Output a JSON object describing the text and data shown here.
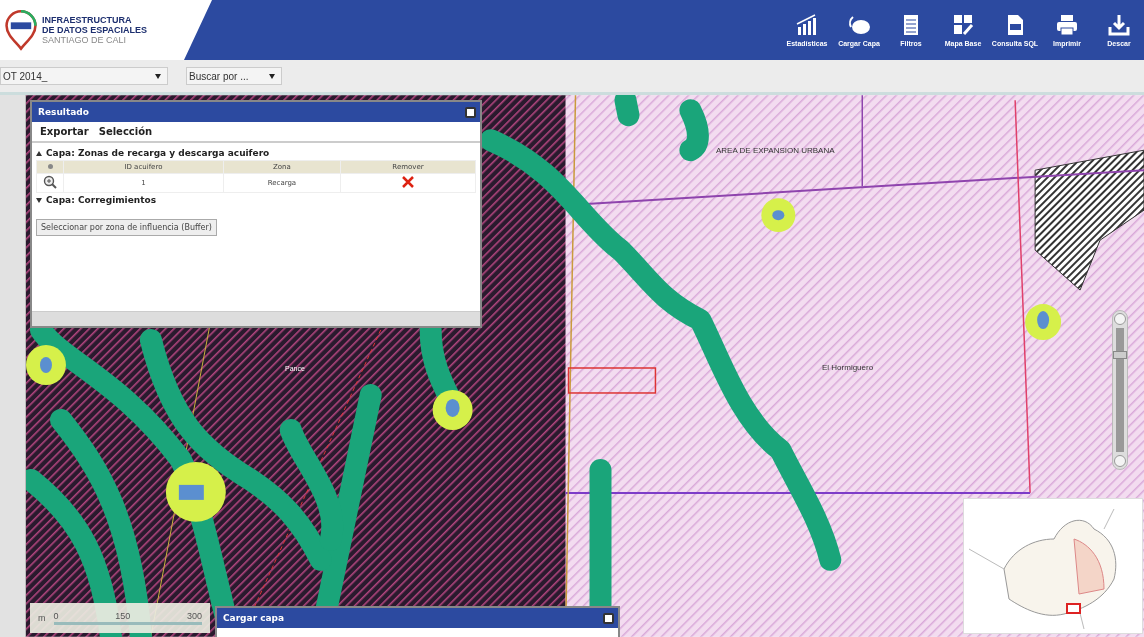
{
  "header": {
    "logo_title": "INFRAESTRUCTURA",
    "logo_subtitle": "DE DATOS ESPACIALES",
    "logo_city": "SANTIAGO DE CALI"
  },
  "toolbar": [
    {
      "label": "Estadísticas",
      "kind": "chart"
    },
    {
      "label": "Cargar Capa",
      "kind": "layers"
    },
    {
      "label": "Filtros",
      "kind": "filter"
    },
    {
      "label": "Mapa Base",
      "kind": "basemap"
    },
    {
      "label": "Consulta SQL",
      "kind": "sql"
    },
    {
      "label": "Imprimir",
      "kind": "print"
    },
    {
      "label": "Descar",
      "kind": "download"
    }
  ],
  "selects": [
    {
      "value": "OT 2014_"
    },
    {
      "value": "Buscar por ..."
    }
  ],
  "map_labels": [
    {
      "text": "AREA DE EXPANSION URBANA",
      "kind": "dark"
    },
    {
      "text": "El Hormiguero",
      "kind": "dark"
    },
    {
      "text": "Pance",
      "kind": "light"
    }
  ],
  "zoom_slider": {
    "level": 0.8
  },
  "scale": {
    "unit": "m",
    "ticks": [
      "0",
      "150",
      "300"
    ]
  },
  "result_panel": {
    "title": "Resultado",
    "menu": [
      "Exportar",
      "Selección"
    ],
    "layers": [
      {
        "title": "Capa: Zonas de recarga y descarga acuifero",
        "expanded": true,
        "columns": [
          "ID acuifero",
          "Zona",
          "Remover"
        ],
        "rows": [
          {
            "id": "1",
            "zona": "Recarga"
          }
        ]
      },
      {
        "title": "Capa: Corregimientos",
        "expanded": false
      }
    ],
    "buffer_button": "Seleccionar por zona de influencia (Buffer)"
  },
  "load_panel": {
    "title": "Cargar capa"
  }
}
